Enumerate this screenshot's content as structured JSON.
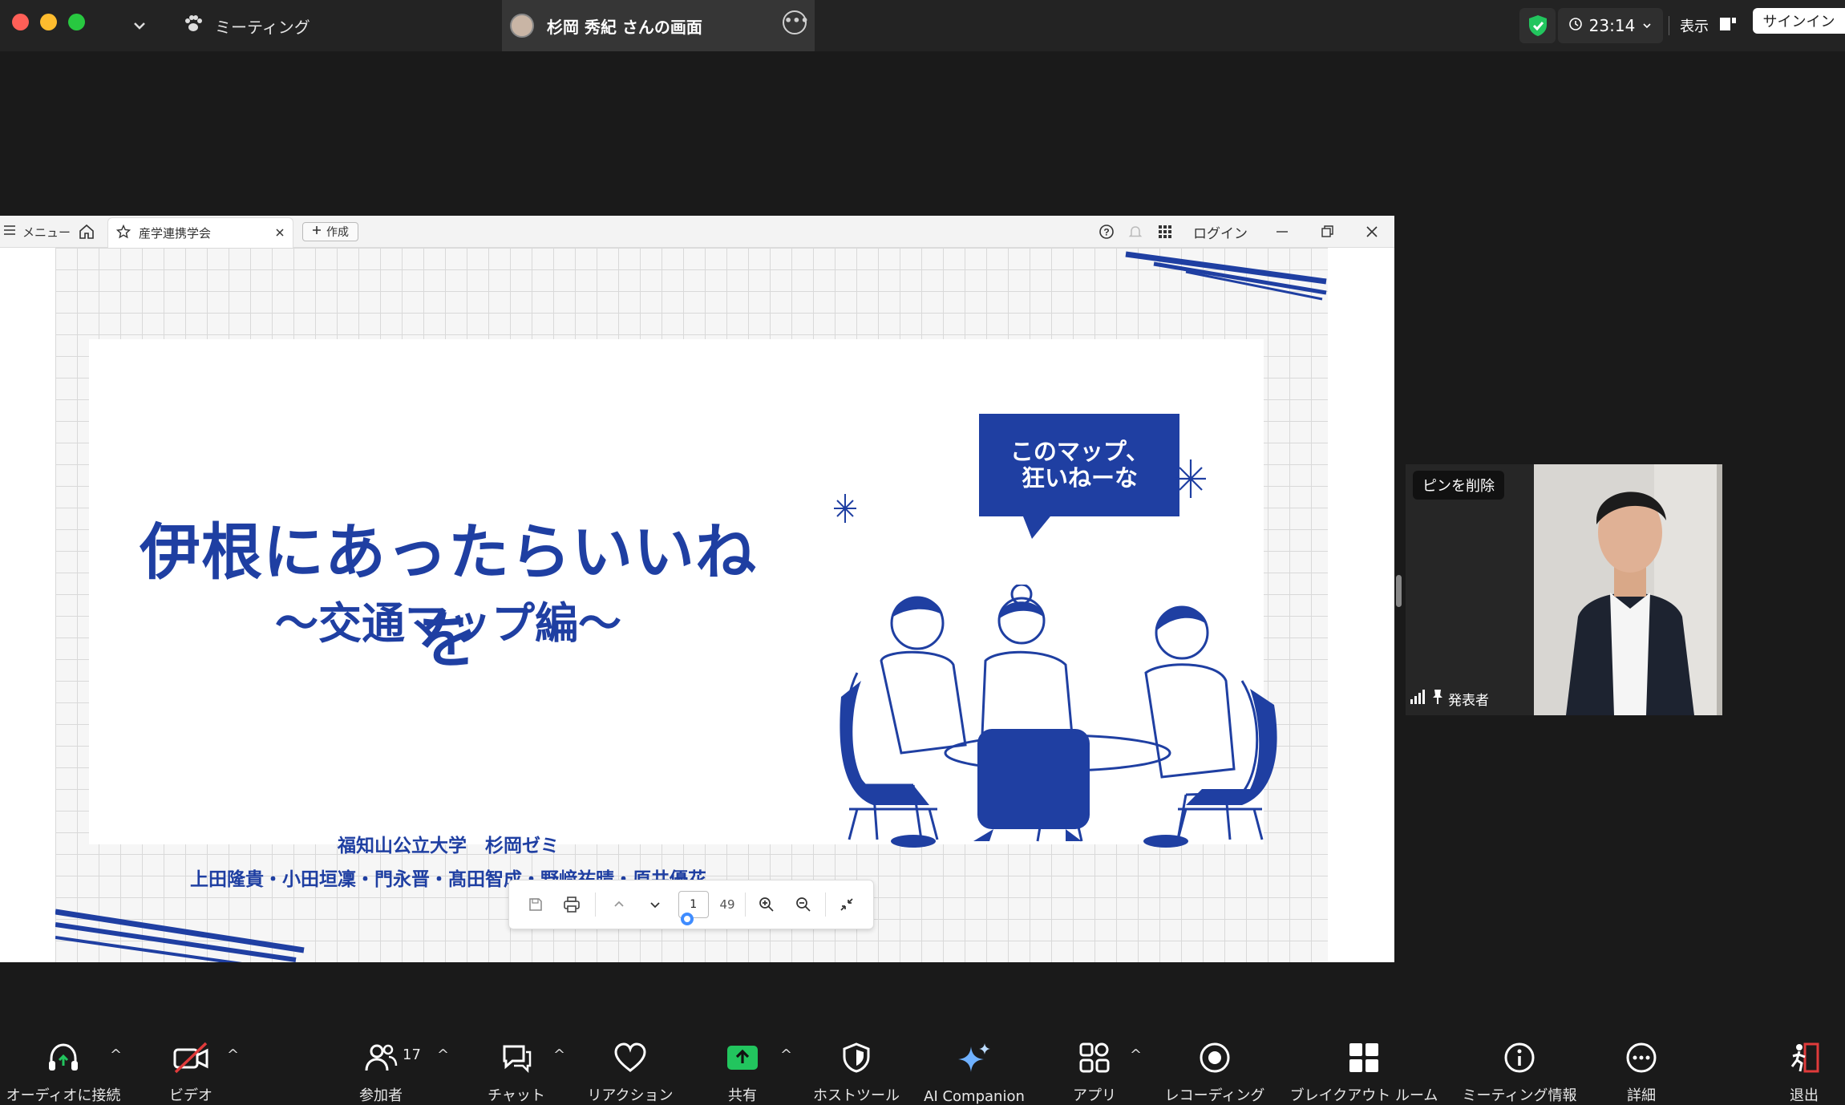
{
  "titlebar": {
    "meeting_tab": "ミーティング",
    "screen_tab": "杉岡 秀紀 さんの画面",
    "clock": "23:14",
    "view_label": "表示",
    "signin_label": "サインイン"
  },
  "viewer": {
    "menu_label": "メニュー",
    "doc_tab_label": "産学連携学会",
    "new_label": "作成",
    "login_label": "ログイン"
  },
  "slide": {
    "title": "伊根にあったらいいねを",
    "subtitle": "～交通マップ編～",
    "affiliation": "福知山公立大学　杉岡ゼミ",
    "authors": "上田隆貴・小田垣凜・門永晋・髙田智成・野﨑祐晴・原井優花",
    "speech_line1": "このマップ、",
    "speech_line2": "狂いねーな"
  },
  "pdf_toolbar": {
    "current_page": "1",
    "total_pages": "49"
  },
  "video": {
    "unpin_label": "ピンを削除",
    "presenter_label": "発表者"
  },
  "toolbar": {
    "audio": "オーディオに接続",
    "video": "ビデオ",
    "participants": "参加者",
    "participants_count": "17",
    "chat": "チャット",
    "reaction": "リアクション",
    "share": "共有",
    "host_tools": "ホストツール",
    "ai": "AI Companion",
    "apps": "アプリ",
    "recording": "レコーディング",
    "breakout": "ブレイクアウト ルーム",
    "meeting_info": "ミーティング情報",
    "more": "詳細",
    "leave": "退出"
  },
  "colors": {
    "slide_blue": "#1f3fa2",
    "share_green": "#22c55e",
    "leave_red": "#e03b3b"
  }
}
